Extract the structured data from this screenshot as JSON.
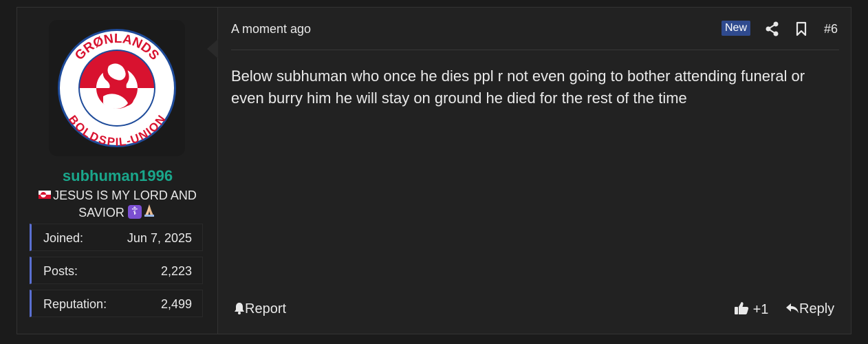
{
  "user": {
    "avatar_alt": "Grønlands Boldspil-Union logo",
    "avatar_top_text": "GRØNLANDS",
    "avatar_bottom_text": "BOLDSPIL-UNION",
    "username": "subhuman1996",
    "title": "JESUS IS MY LORD AND SAVIOR",
    "stats": [
      {
        "label": "Joined:",
        "value": "Jun 7, 2025"
      },
      {
        "label": "Posts:",
        "value": "2,223"
      },
      {
        "label": "Reputation:",
        "value": "2,499"
      }
    ],
    "accent": "#1aa68b"
  },
  "post": {
    "time": "A moment ago",
    "badge": "New",
    "number": "#6",
    "message": "Below subhuman who once he dies ppl r not even going to bother attending funeral or even burry him he will stay on ground he died for the rest of the time",
    "report_label": "Report",
    "like_count": "+1",
    "reply_label": "Reply"
  },
  "icons": [
    "share-icon",
    "bookmark-icon",
    "bell-icon",
    "thumbs-up-icon",
    "reply-icon"
  ]
}
